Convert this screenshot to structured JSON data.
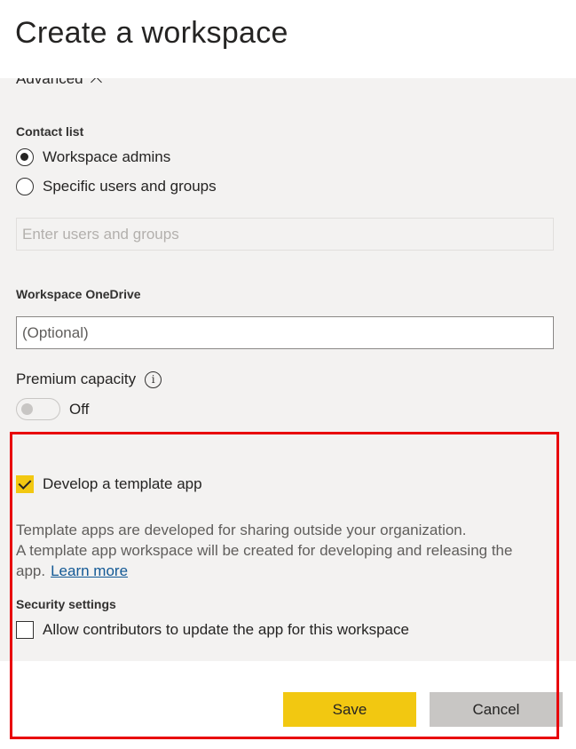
{
  "header": {
    "title": "Create a workspace"
  },
  "advanced": {
    "label": "Advanced",
    "icon": "chevron-up-icon"
  },
  "contact_list": {
    "label": "Contact list",
    "options": [
      {
        "label": "Workspace admins",
        "selected": true
      },
      {
        "label": "Specific users and groups",
        "selected": false
      }
    ],
    "users_placeholder": "Enter users and groups"
  },
  "onedrive": {
    "label": "Workspace OneDrive",
    "placeholder": "(Optional)"
  },
  "premium": {
    "label": "Premium capacity",
    "info_icon": "info-icon",
    "toggle_state": "Off"
  },
  "template_app": {
    "checkbox_label": "Develop a template app",
    "checked": true,
    "desc_line1": "Template apps are developed for sharing outside your organization.",
    "desc_line2": "A template app workspace will be created for developing and releasing the app.",
    "learn_more": "Learn more"
  },
  "security": {
    "label": "Security settings",
    "checkbox_label": "Allow contributors to update the app for this workspace",
    "checked": false
  },
  "footer": {
    "save_label": "Save",
    "cancel_label": "Cancel"
  },
  "colors": {
    "accent": "#f2c811",
    "highlight": "#e8000b",
    "link": "#135995",
    "panel_bg": "#f3f2f1"
  }
}
